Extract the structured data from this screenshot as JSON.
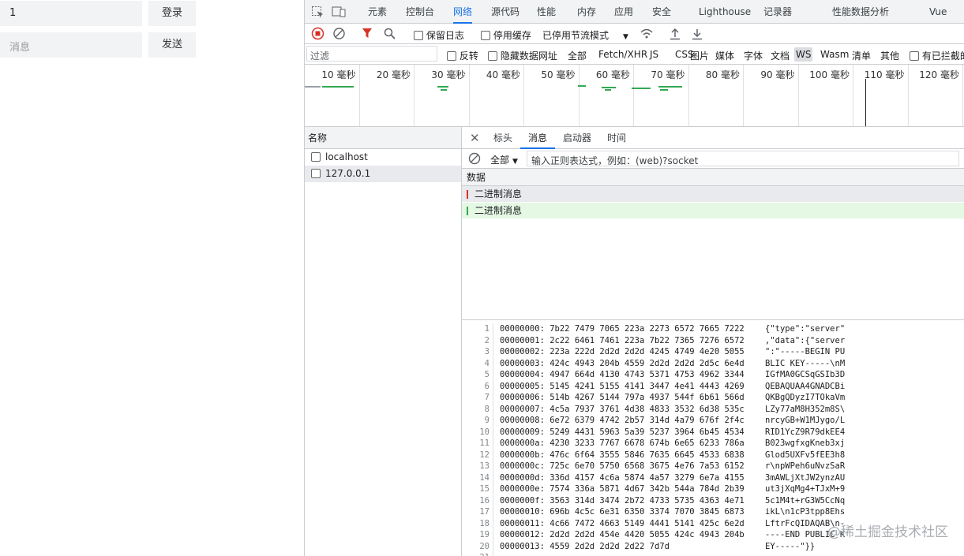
{
  "page": {
    "user_input_value": "1",
    "login_label": "登录",
    "message_placeholder": "消息",
    "send_label": "发送"
  },
  "devtools": {
    "tabs": [
      "元素",
      "控制台",
      "网络",
      "源代码",
      "性能",
      "内存",
      "应用",
      "安全",
      "Lighthouse",
      "记录器",
      "性能数据分析",
      "Vue"
    ],
    "active_tab": "网络",
    "toolbar": {
      "preserve_log": "保留日志",
      "disable_cache": "停用缓存",
      "throttle": "已停用节流模式"
    },
    "filter": {
      "placeholder": "过滤",
      "invert": "反转",
      "hide_data_urls": "隐藏数据网址",
      "types": [
        "全部",
        "Fetch/XHR",
        "JS",
        "CSS",
        "图片",
        "媒体",
        "字体",
        "文档",
        "WS",
        "Wasm",
        "清单",
        "其他"
      ],
      "active_type": "WS",
      "blocked": "有已拦截的"
    },
    "timeline_ticks": [
      "10 毫秒",
      "20 毫秒",
      "30 毫秒",
      "40 毫秒",
      "50 毫秒",
      "60 毫秒",
      "70 毫秒",
      "80 毫秒",
      "90 毫秒",
      "100 毫秒",
      "110 毫秒",
      "120 毫秒"
    ],
    "name_header": "名称",
    "requests": [
      "localhost",
      "127.0.0.1"
    ],
    "detail_tabs": [
      "标头",
      "消息",
      "启动器",
      "时间"
    ],
    "active_detail_tab": "消息",
    "message_filter_type": "全部",
    "message_filter_placeholder": "输入正则表达式，例如：(web)?socket",
    "data_header": "数据",
    "messages": [
      {
        "text": "二进制消息",
        "direction": "sent"
      },
      {
        "text": "二进制消息",
        "direction": "received"
      }
    ],
    "hex_lines": [
      "00000000: 7b22 7479 7065 223a 2273 6572 7665 7222",
      "00000001: 2c22 6461 7461 223a 7b22 7365 7276 6572",
      "00000002: 223a 222d 2d2d 2d2d 4245 4749 4e20 5055",
      "00000003: 424c 4943 204b 4559 2d2d 2d2d 2d5c 6e4d",
      "00000004: 4947 664d 4130 4743 5371 4753 4962 3344",
      "00000005: 5145 4241 5155 4141 3447 4e41 4443 4269",
      "00000006: 514b 4267 5144 797a 4937 544f 6b61 566d",
      "00000007: 4c5a 7937 3761 4d38 4833 3532 6d38 535c",
      "00000008: 6e72 6379 4742 2b57 314d 4a79 676f 2f4c",
      "00000009: 5249 4431 5963 5a39 5237 3964 6b45 4534",
      "0000000a: 4230 3233 7767 6678 674b 6e65 6233 786a",
      "0000000b: 476c 6f64 3555 5846 7635 6645 4533 6838",
      "0000000c: 725c 6e70 5750 6568 3675 4e76 7a53 6152",
      "0000000d: 336d 4157 4c6a 5874 4a57 3279 6e7a 4155",
      "0000000e: 7574 336a 5871 4d67 342b 544a 784d 2b39",
      "0000000f: 3563 314d 3474 2b72 4733 5735 4363 4e71",
      "00000010: 696b 4c5c 6e31 6350 3374 7070 3845 6873",
      "00000011: 4c66 7472 4663 5149 4441 5141 425c 6e2d",
      "00000012: 2d2d 2d2d 454e 4420 5055 424c 4943 204b",
      "00000013: 4559 2d2d 2d2d 2d22 7d7d"
    ],
    "ascii_lines": [
      "{\"type\":\"server\"",
      ",\"data\":{\"server",
      "\":\"-----BEGIN PU",
      "BLIC KEY-----\\nM",
      "IGfMA0GCSqGSIb3D",
      "QEBAQUAA4GNADCBi",
      "QKBgQDyzI7TOkaVm",
      "LZy77aM8H352m8S\\",
      "nrcyGB+W1MJygo/L",
      "RID1YcZ9R79dkEE4",
      "B023wgfxgKneb3xj",
      "Glod5UXFv5fEE3h8",
      "r\\npWPeh6uNvzSaR",
      "3mAWLjXtJW2ynzAU",
      "ut3jXqMg4+TJxM+9",
      "5c1M4t+rG3W5CcNq",
      "ikL\\n1cP3tpp8Ehs",
      "LftrFcQIDAQAB\\n-",
      "----END PUBLIC K",
      "EY-----\"}}"
    ],
    "line_count": 21
  },
  "watermark": "@稀土掘金技术社区",
  "colors": {
    "accent": "#1a73e8",
    "sent_marker": "#d93025",
    "received_marker": "#34a853",
    "received_bg": "#e4f8e4"
  }
}
